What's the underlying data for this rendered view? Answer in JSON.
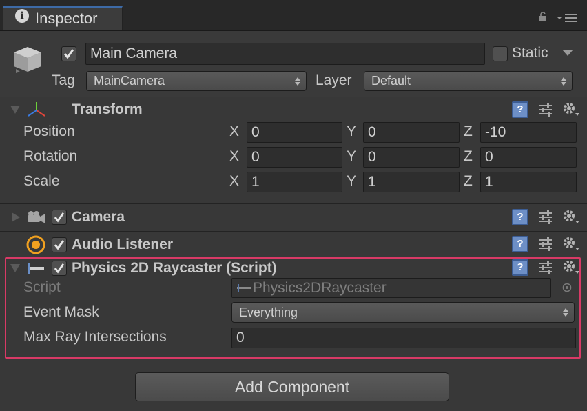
{
  "tab": {
    "title": "Inspector",
    "icon": "info-icon"
  },
  "header": {
    "object_name": "Main Camera",
    "static_label": "Static",
    "tag_label": "Tag",
    "tag_value": "MainCamera",
    "layer_label": "Layer",
    "layer_value": "Default"
  },
  "transform": {
    "title": "Transform",
    "rows": [
      {
        "label": "Position",
        "x": "0",
        "y": "0",
        "z": "-10"
      },
      {
        "label": "Rotation",
        "x": "0",
        "y": "0",
        "z": "0"
      },
      {
        "label": "Scale",
        "x": "1",
        "y": "1",
        "z": "1"
      }
    ],
    "axis_x": "X",
    "axis_y": "Y",
    "axis_z": "Z"
  },
  "camera": {
    "title": "Camera"
  },
  "audio_listener": {
    "title": "Audio Listener"
  },
  "raycaster": {
    "title": "Physics 2D Raycaster (Script)",
    "script_label": "Script",
    "script_value": "Physics2DRaycaster",
    "event_mask_label": "Event Mask",
    "event_mask_value": "Everything",
    "max_ray_label": "Max Ray Intersections",
    "max_ray_value": "0"
  },
  "add_component_label": "Add Component",
  "colors": {
    "highlight": "#d83a66",
    "tab_accent": "#3d6aa6",
    "background": "#383838"
  }
}
